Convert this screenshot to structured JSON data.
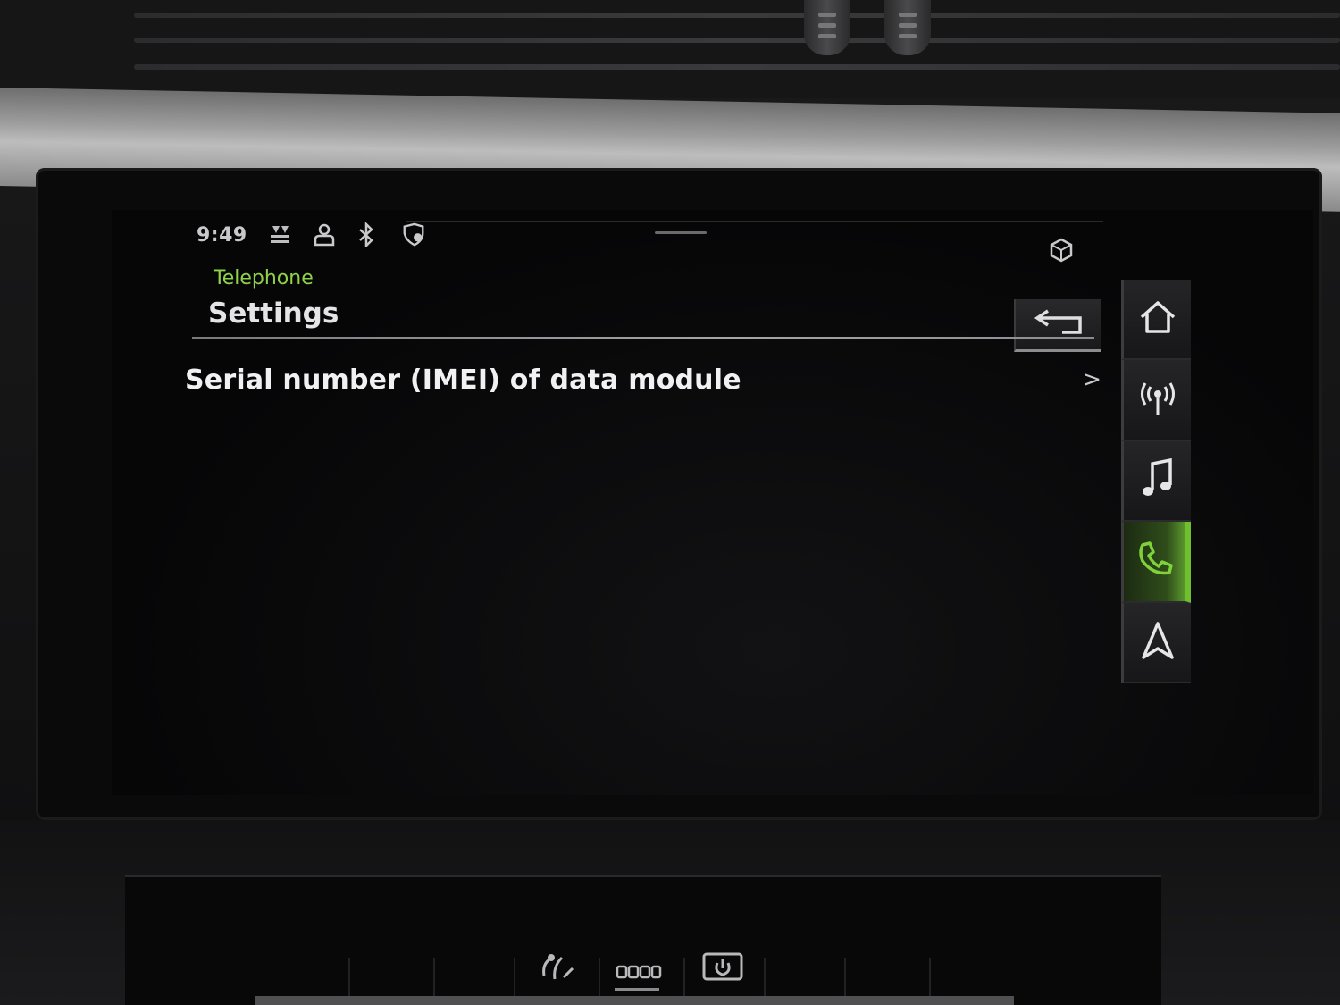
{
  "status_bar": {
    "time": "9:49",
    "icons": [
      "data-connection-icon",
      "user-profile-icon",
      "bluetooth-icon",
      "location-shield-icon"
    ],
    "right_icon": "cube-icon"
  },
  "header": {
    "breadcrumb": "Telephone",
    "title": "Settings",
    "back_icon": "back-arrow-icon"
  },
  "list": {
    "items": [
      {
        "label": "Serial number (IMEI) of data module",
        "chevron": ">"
      }
    ]
  },
  "nav_rail": {
    "items": [
      {
        "icon": "home-icon",
        "active": false
      },
      {
        "icon": "radio-icon",
        "active": false
      },
      {
        "icon": "music-note-icon",
        "active": false
      },
      {
        "icon": "phone-icon",
        "active": true
      },
      {
        "icon": "navigation-icon",
        "active": false
      }
    ]
  },
  "lower_console": {
    "icons": [
      "climate-airflow-icon",
      "seat-heating-icon",
      "screen-power-icon"
    ]
  },
  "colors": {
    "accent": "#6fbf2e",
    "breadcrumb": "#8fd14a",
    "text": "#f1f1f3",
    "screen_bg": "#060607"
  }
}
